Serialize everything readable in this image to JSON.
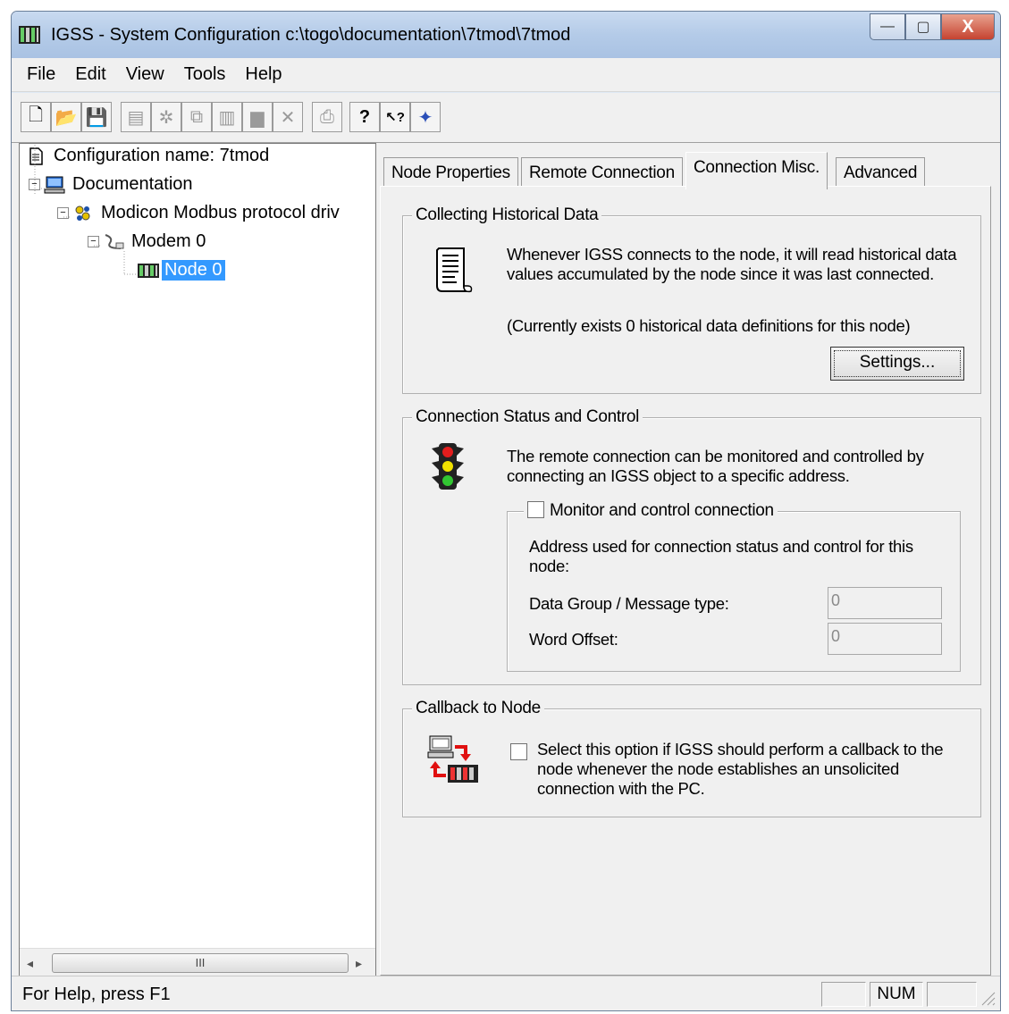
{
  "window": {
    "title": "IGSS -  System Configuration c:\\togo\\documentation\\7tmod\\7tmod",
    "min_glyph": "—",
    "max_glyph": "▢",
    "close_glyph": "X"
  },
  "menu": [
    "File",
    "Edit",
    "View",
    "Tools",
    "Help"
  ],
  "toolbar": [
    {
      "icon": "new-document-icon",
      "glyph": "🗋",
      "enabled": true
    },
    {
      "icon": "open-folder-icon",
      "glyph": "📂",
      "enabled": true
    },
    {
      "icon": "save-icon",
      "glyph": "💾",
      "enabled": true
    },
    {
      "icon": "node-icon",
      "glyph": "▤",
      "enabled": false
    },
    {
      "icon": "driver-icon",
      "glyph": "✲",
      "enabled": false
    },
    {
      "icon": "copy-icon",
      "glyph": "⧉",
      "enabled": false
    },
    {
      "icon": "table-icon",
      "glyph": "▥",
      "enabled": false
    },
    {
      "icon": "area-icon",
      "glyph": "▆",
      "enabled": false
    },
    {
      "icon": "delete-icon",
      "glyph": "✕",
      "enabled": false
    },
    {
      "icon": "print-icon",
      "glyph": "⎙",
      "enabled": false
    },
    {
      "icon": "help-icon",
      "glyph": "?",
      "enabled": true
    },
    {
      "icon": "context-help-icon",
      "glyph": "↖?",
      "enabled": true
    },
    {
      "icon": "wizard-icon",
      "glyph": "✦",
      "enabled": true
    }
  ],
  "tree": {
    "config_label": "Configuration name: 7tmod",
    "items": [
      {
        "label": "Documentation",
        "icon": "computer-icon"
      },
      {
        "label": "Modicon Modbus protocol driv",
        "icon": "driver-icon"
      },
      {
        "label": "Modem 0",
        "icon": "modem-icon"
      },
      {
        "label": "Node 0",
        "icon": "node-icon",
        "selected": true
      }
    ],
    "scroll_thumb": "III"
  },
  "tabs": [
    "Node Properties",
    "Remote Connection",
    "Connection Misc.",
    "Advanced"
  ],
  "active_tab": "Connection Misc.",
  "historical": {
    "legend": "Collecting Historical Data",
    "text": "Whenever IGSS connects to the node, it will read historical data values accumulated by the node since it was last connected.",
    "count_text": "(Currently exists 0 historical data definitions for this node)",
    "settings_label": "Settings..."
  },
  "connection_status": {
    "legend": "Connection Status and Control",
    "text": "The remote connection can be monitored and controlled by connecting an IGSS object to a specific address.",
    "monitor_label": "Monitor and control  connection",
    "address_text": "Address used for  connection  status and control  for this node:",
    "data_group_label": "Data Group / Message type:",
    "data_group_value": "0",
    "word_offset_label": "Word Offset:",
    "word_offset_value": "0"
  },
  "callback": {
    "legend": "Callback to Node",
    "text": "Select this option if IGSS should perform a callback to the node whenever the node establishes an unsolicited connection with the PC."
  },
  "status": {
    "help_text": "For Help, press F1",
    "num": "NUM"
  },
  "colors": {
    "selection": "#3399ff",
    "close_button": "#c54330",
    "title_bar": "#b4cbe8"
  }
}
